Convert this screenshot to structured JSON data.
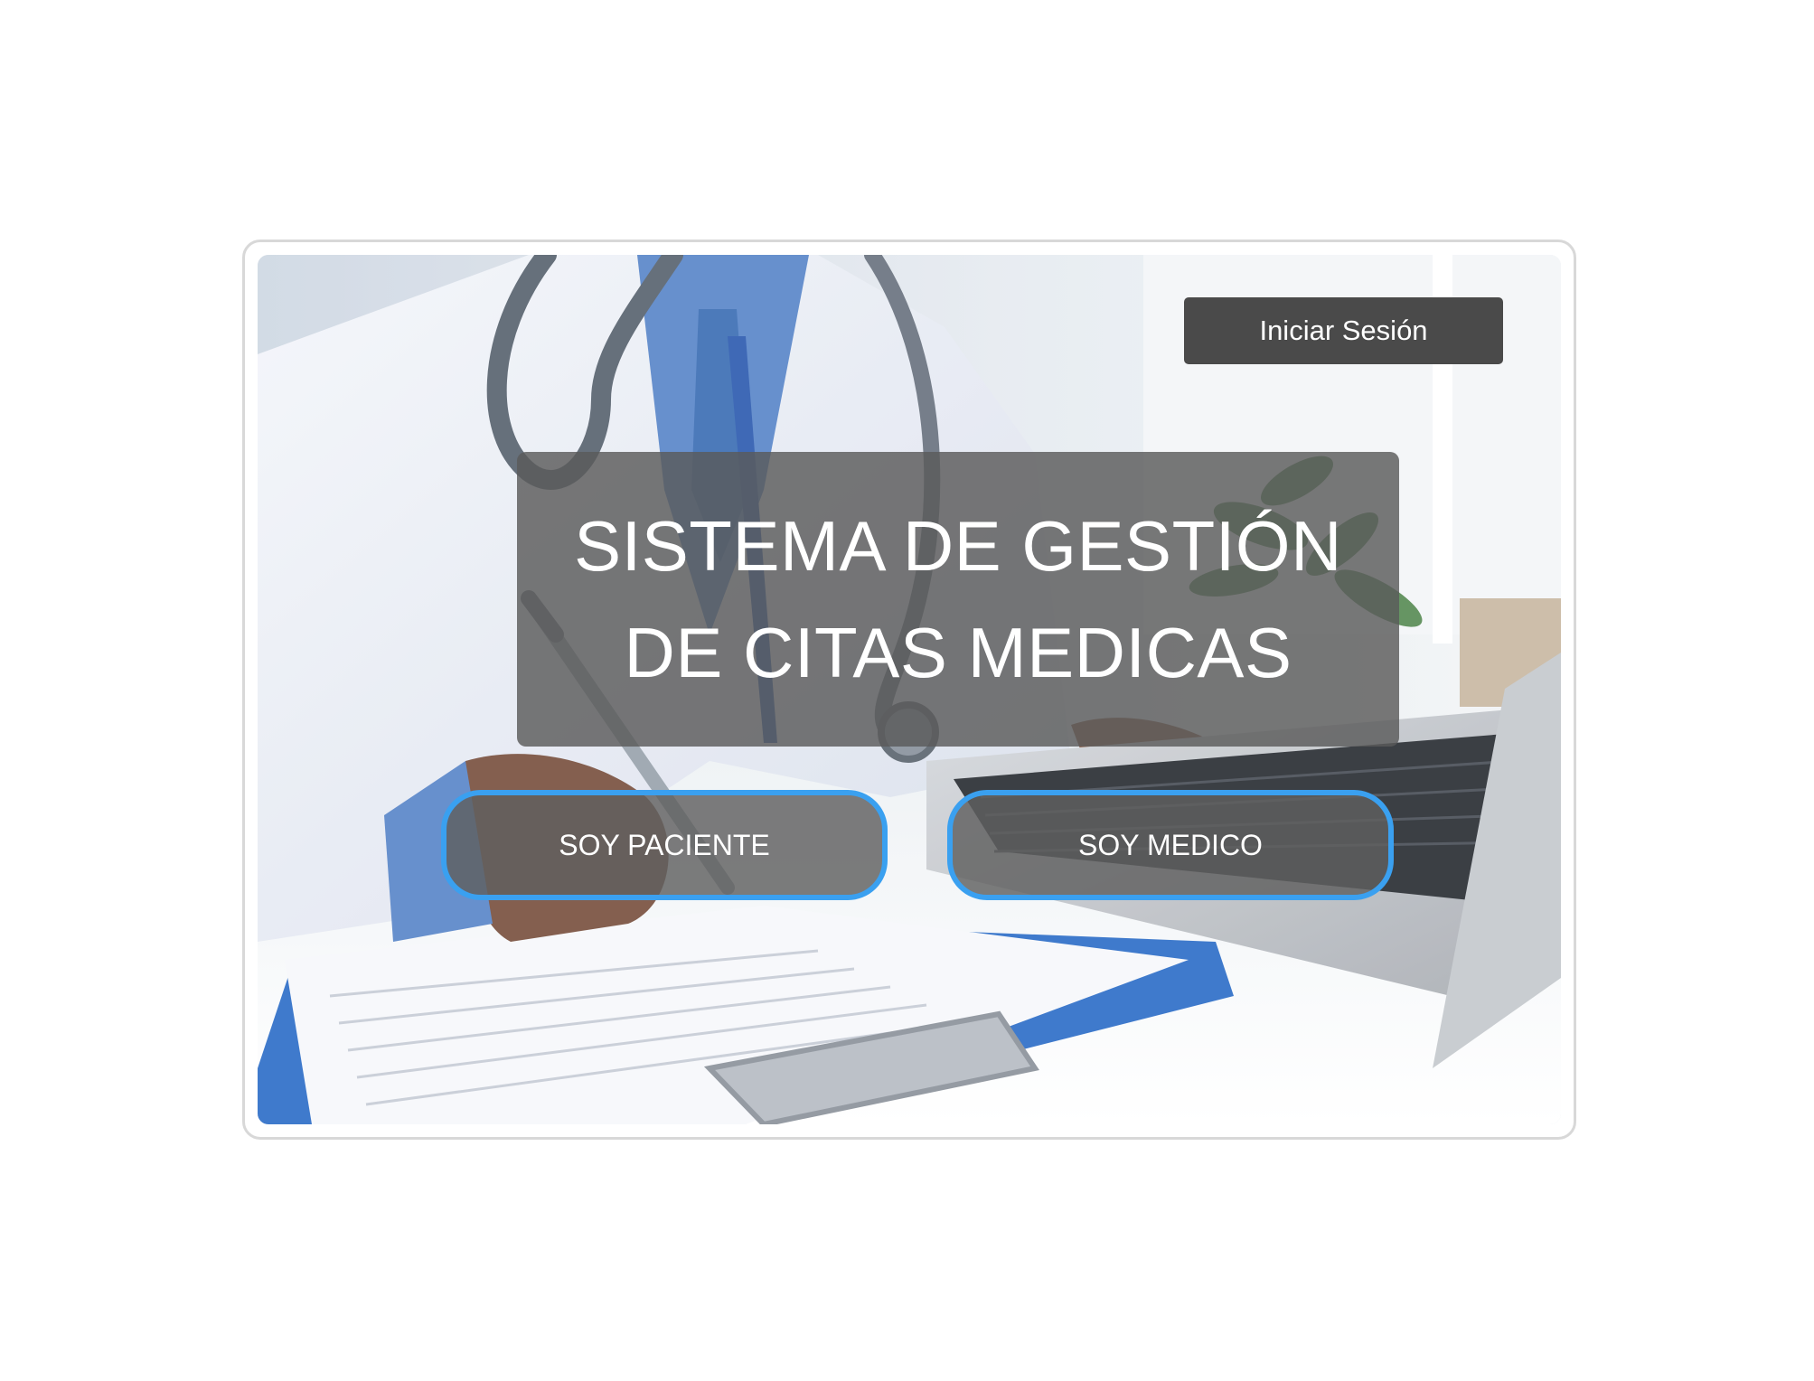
{
  "header": {
    "login_label": "Iniciar Sesión"
  },
  "hero": {
    "title_line_1": "SISTEMA DE GESTIÓN",
    "title_line_2": "DE CITAS MEDICAS",
    "image_subject": "doctor-writing-at-desk-with-laptop"
  },
  "actions": {
    "patient_label": "SOY PACIENTE",
    "doctor_label": "SOY MEDICO"
  },
  "colors": {
    "button_border": "#3aa0f0",
    "login_bg": "#4a4a4a",
    "overlay": "#5a5a5a"
  }
}
